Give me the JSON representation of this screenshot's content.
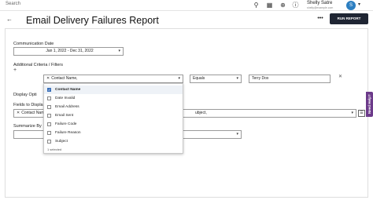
{
  "topbar": {
    "search_label": "Search",
    "user_name": "Shelly Satre",
    "user_sub": "shelly@example.com",
    "icons": [
      "search-icon",
      "grid-icon",
      "plus-circle-icon",
      "help-icon"
    ]
  },
  "header": {
    "title": "Email Delivery Failures Report",
    "more_label": "•••",
    "run_label": "RUN REPORT"
  },
  "form": {
    "communication_date_label": "Communication Date",
    "date_value": "Jan 1, 2022 - Dec 31, 2022",
    "criteria_label": "Additional Criteria / Filters",
    "criteria_field_chip": "Contact Name,",
    "operator_value": "Equals",
    "criteria_value": "Terry Dox",
    "display_options_label": "Display Opti",
    "fields_label": "Fields to Displa",
    "fields_chip": "Contact Nam",
    "fields_tail": "ubject,",
    "summarize_label": "Summarize By"
  },
  "dropdown": {
    "options": [
      {
        "label": "Contact Name",
        "checked": true
      },
      {
        "label": "Date Invalid",
        "checked": false
      },
      {
        "label": "Email Address",
        "checked": false
      },
      {
        "label": "Email Sent",
        "checked": false
      },
      {
        "label": "Failure Code",
        "checked": false
      },
      {
        "label": "Failure Reason",
        "checked": false
      },
      {
        "label": "Subject",
        "checked": false
      }
    ],
    "footer": "1 selected"
  },
  "side_help": {
    "label": "Need Help?"
  },
  "colors": {
    "primary_button": "#1f2533",
    "help_tab": "#6c3a8a",
    "checkbox_on": "#3a6fb8"
  }
}
